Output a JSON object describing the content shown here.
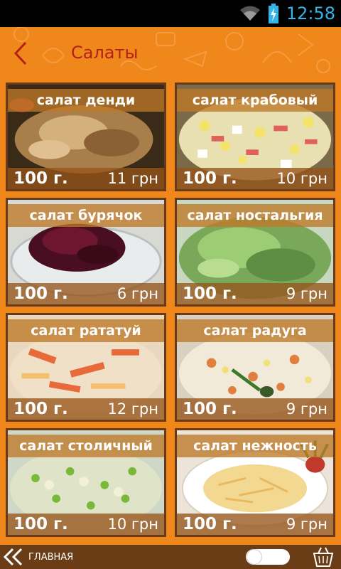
{
  "status": {
    "time": "12:58",
    "wifi_icon": "wifi-icon",
    "battery_icon": "battery-charging-icon"
  },
  "header": {
    "title": "Салаты",
    "back_icon": "back-arrow-icon"
  },
  "cards": [
    {
      "title": "салат денди",
      "weight": "100 г.",
      "price": "11 грн"
    },
    {
      "title": "салат крабовый",
      "weight": "100 г.",
      "price": "10 грн"
    },
    {
      "title": "салат бурячок",
      "weight": "100 г.",
      "price": "6 грн"
    },
    {
      "title": "салат ностальгия",
      "weight": "100 г.",
      "price": "9 грн"
    },
    {
      "title": "салат рататуй",
      "weight": "100 г.",
      "price": "12 грн"
    },
    {
      "title": "салат радуга",
      "weight": "100 г.",
      "price": "9 грн"
    },
    {
      "title": "салат столичный",
      "weight": "100 г.",
      "price": "10 грн"
    },
    {
      "title": "салат нежность",
      "weight": "100 г.",
      "price": "9 грн"
    }
  ],
  "footer": {
    "home_label": "ГЛАВНАЯ",
    "home_icon": "double-chevron-left-icon",
    "basket_icon": "basket-icon"
  },
  "colors": {
    "background": "#f0871a",
    "title": "#b3221a",
    "footer": "#6a3d17"
  }
}
